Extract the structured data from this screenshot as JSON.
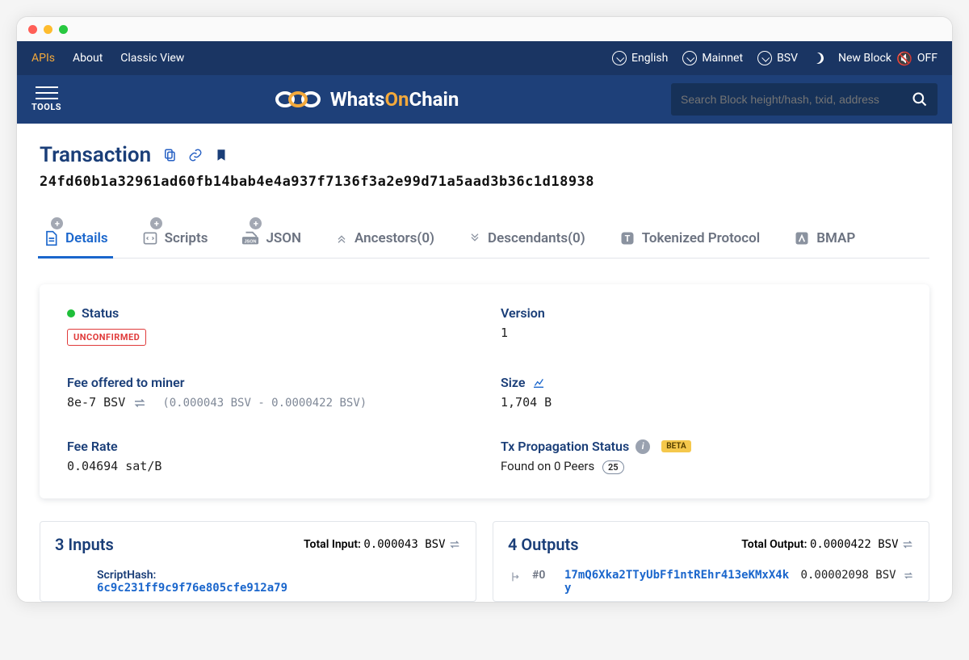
{
  "topnav": {
    "apis": "APIs",
    "about": "About",
    "classic": "Classic View",
    "language": "English",
    "network": "Mainnet",
    "coin": "BSV",
    "newblock_label": "New Block",
    "sound_state": "OFF"
  },
  "header": {
    "tools": "TOOLS",
    "brand_whats": "Whats",
    "brand_on": "On",
    "brand_chain": "Chain",
    "search_placeholder": "Search Block height/hash, txid, address"
  },
  "page": {
    "title": "Transaction",
    "txid": "24fd60b1a32961ad60fb14bab4e4a937f7136f3a2e99d71a5aad3b36c1d18938"
  },
  "tabs": {
    "details": "Details",
    "scripts": "Scripts",
    "json": "JSON",
    "ancestors": "Ancestors(0)",
    "descendants": "Descendants(0)",
    "tokenized": "Tokenized Protocol",
    "bmap": "BMAP"
  },
  "details": {
    "status_label": "Status",
    "status_value": "UNCONFIRMED",
    "version_label": "Version",
    "version_value": "1",
    "fee_label": "Fee offered to miner",
    "fee_value": "8e-7 BSV",
    "fee_detail": "(0.000043 BSV - 0.0000422 BSV)",
    "size_label": "Size",
    "size_value": "1,704 B",
    "feerate_label": "Fee Rate",
    "feerate_value": "0.04694 sat/B",
    "propagation_label": "Tx Propagation Status",
    "propagation_value": "Found on 0 Peers",
    "propagation_count": "25",
    "beta": "BETA"
  },
  "inputs": {
    "title": "3 Inputs",
    "total_label": "Total Input:",
    "total_value": "0.000043 BSV",
    "first_label": "ScriptHash:",
    "first_hash": "6c9c231ff9c9f76e805cfe912a79"
  },
  "outputs": {
    "title": "4 Outputs",
    "total_label": "Total Output:",
    "total_value": "0.0000422 BSV",
    "row0_index": "#0",
    "row0_addr": "17mQ6Xka2TTyUbFf1ntREhr413eKMxX4ky",
    "row0_amount": "0.00002098 BSV"
  }
}
